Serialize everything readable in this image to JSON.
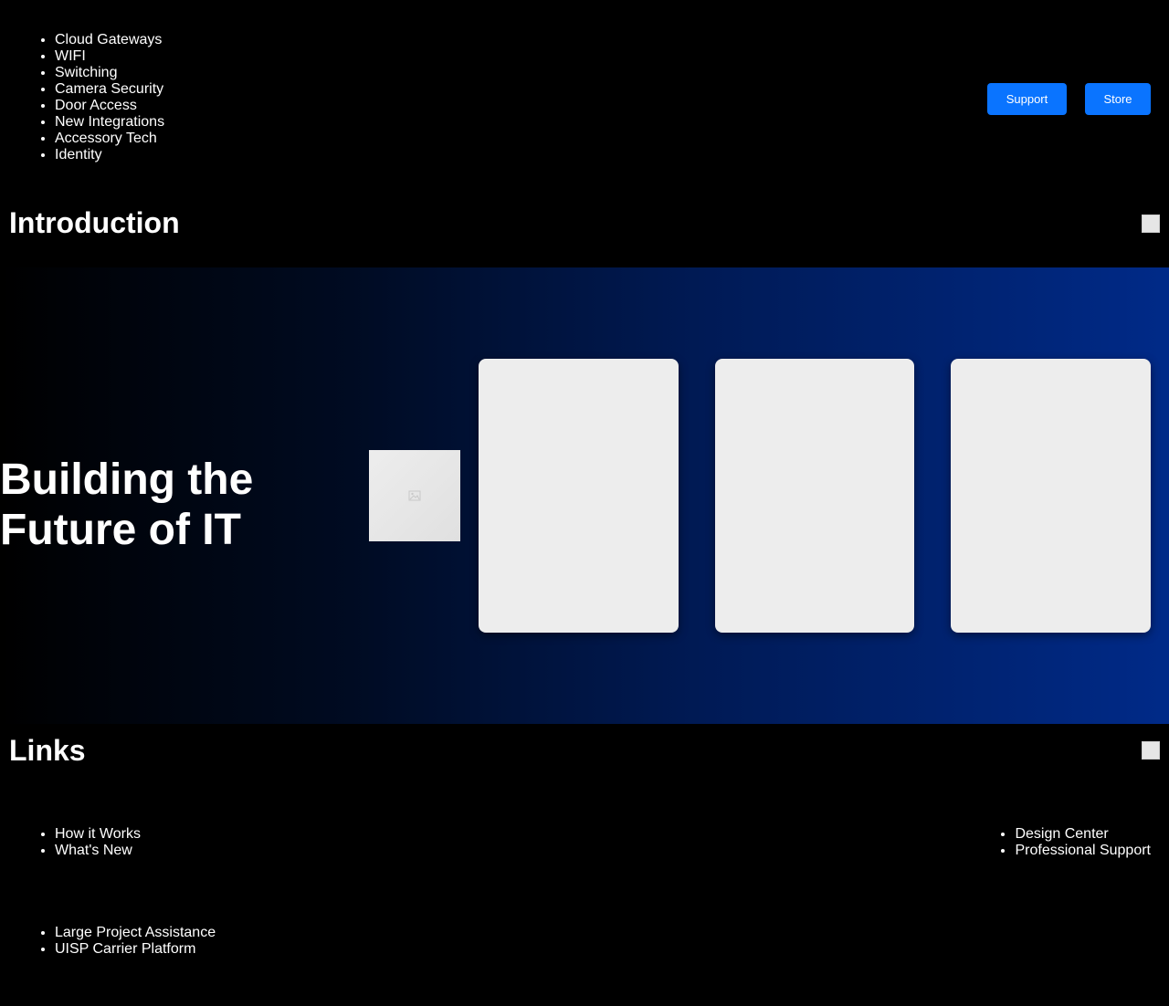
{
  "header": {
    "nav_items": [
      {
        "label": "Cloud Gateways"
      },
      {
        "label": "WIFI"
      },
      {
        "label": "Switching"
      },
      {
        "label": "Camera Security"
      },
      {
        "label": "Door Access"
      },
      {
        "label": "New Integrations"
      },
      {
        "label": "Accessory Tech"
      },
      {
        "label": "Identity"
      }
    ],
    "support_label": "Support",
    "store_label": "Store"
  },
  "intro": {
    "heading": "Introduction"
  },
  "hero": {
    "title": "Building the Future of IT",
    "thumbnail_icon": "broken-image-icon"
  },
  "links": {
    "heading": "Links",
    "group_a": [
      {
        "label": "How it Works"
      },
      {
        "label": "What's New"
      }
    ],
    "group_b": [
      {
        "label": "Design Center"
      },
      {
        "label": "Professional Support"
      }
    ],
    "group_c": [
      {
        "label": "Large Project Assistance"
      },
      {
        "label": "UISP Carrier Platform"
      }
    ]
  },
  "colors": {
    "background": "#000000",
    "button_blue": "#0a74ff",
    "hero_gradient_end": "#002a88",
    "card_fill": "#ededed"
  }
}
